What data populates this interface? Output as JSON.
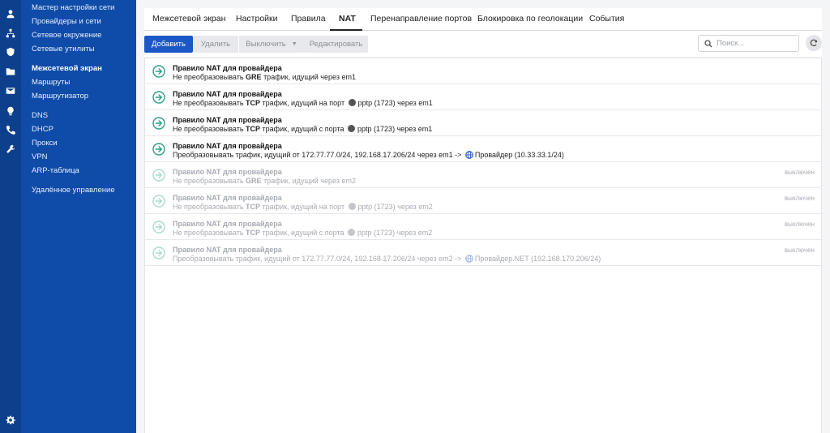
{
  "sidebar": {
    "items": [
      "Мастер настройки сети",
      "Провайдеры и сети",
      "Сетевое окружение",
      "Сетевые утилиты",
      "Межсетевой экран",
      "Маршруты",
      "Маршрутизатор",
      "DNS",
      "DHCP",
      "Прокси",
      "VPN",
      "ARP-таблица",
      "Удалённое управление"
    ]
  },
  "rail_icons": [
    "user-icon",
    "network-icon",
    "shield-icon",
    "folder-icon",
    "mail-icon",
    "bulb-icon",
    "phone-icon",
    "wrench-icon",
    "settings-icon"
  ],
  "tabs": [
    "Межсетевой экран",
    "Настройки",
    "Правила",
    "NAT",
    "Перенаправление портов",
    "Блокировка по геолокации",
    "События"
  ],
  "active_tab": "NAT",
  "toolbar": {
    "add": "Добавить",
    "delete": "Удалить",
    "disable": "Выключить",
    "edit": "Редактировать",
    "search_placeholder": "Поиск..."
  },
  "status_off": "выключен",
  "rules": [
    {
      "title": "Правило NAT для провайдера",
      "d1": "Не преобразовывать ",
      "proto": "GRE",
      "d2": " трафик, идущий через em1",
      "port": "",
      "d3": "",
      "provider": "",
      "enabled": true
    },
    {
      "title": "Правило NAT для провайдера",
      "d1": "Не преобразовывать ",
      "proto": "TCP",
      "d2": " трафик, идущий на порт",
      "port": "pptp (1723)",
      "d3": " через em1",
      "provider": "",
      "enabled": true
    },
    {
      "title": "Правило NAT для провайдера",
      "d1": "Не преобразовывать ",
      "proto": "TCP",
      "d2": " трафик, идущий с порта",
      "port": "pptp (1723)",
      "d3": " через em1",
      "provider": "",
      "enabled": true
    },
    {
      "title": "Правило NAT для провайдера",
      "d1": "Преобразовывать трафик, идущий от 172.77.77.0/24, 192.168.17.206/24 через em1 ->",
      "proto": "",
      "d2": "",
      "port": "",
      "d3": "",
      "provider": "Провайдер (10.33.33.1/24)",
      "enabled": true
    },
    {
      "title": "Правило NAT для провайдера",
      "d1": "Не преобразовывать ",
      "proto": "GRE",
      "d2": " трафик, идущий через em2",
      "port": "",
      "d3": "",
      "provider": "",
      "enabled": false
    },
    {
      "title": "Правило NAT для провайдера",
      "d1": "Не преобразовывать ",
      "proto": "TCP",
      "d2": " трафик, идущий на порт",
      "port": "pptp (1723)",
      "d3": " через em2",
      "provider": "",
      "enabled": false
    },
    {
      "title": "Правило NAT для провайдера",
      "d1": "Не преобразовывать ",
      "proto": "TCP",
      "d2": " трафик, идущий с порта",
      "port": "pptp (1723)",
      "d3": " через em2",
      "provider": "",
      "enabled": false
    },
    {
      "title": "Правило NAT для провайдера",
      "d1": "Преобразовывать трафик, идущий от 172.77.77.0/24, 192.168.17.206/24 через em2 ->",
      "proto": "",
      "d2": "",
      "port": "",
      "d3": "",
      "provider": "Провайдер.NET (192.168.170.206/24)",
      "enabled": false
    }
  ],
  "colors": {
    "sidebar": "#0f4ba8",
    "rail": "#0c3f8c",
    "primary": "#1b57c6",
    "rule_icon_on": "#2e9e8a",
    "rule_icon_off": "#a9dbd1",
    "globe": "#1b57c6"
  }
}
